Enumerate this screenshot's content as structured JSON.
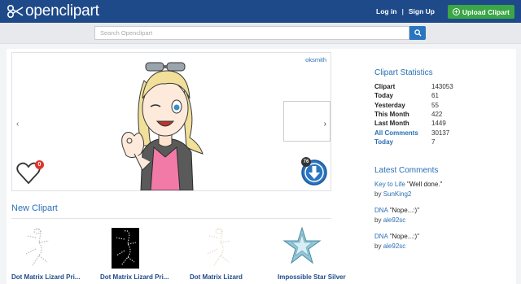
{
  "header": {
    "logo_text": "openclipart",
    "login": "Log in",
    "separator": "|",
    "signup": "Sign Up",
    "upload": "Upload Clipart",
    "brand_color": "#1f4a8a",
    "upload_color": "#3aa646"
  },
  "search": {
    "placeholder": "Search Openclipart",
    "icon": "search-icon"
  },
  "feature": {
    "author": "oksmith",
    "likes": "0",
    "downloads": "76",
    "prev": "‹",
    "next": "›"
  },
  "new_clipart": {
    "heading": "New Clipart",
    "items": [
      {
        "title": "Dot Matrix Lizard Pri..."
      },
      {
        "title": "Dot Matrix Lizard Pri..."
      },
      {
        "title": "Dot Matrix Lizard"
      },
      {
        "title": "Impossible Star Silver"
      }
    ]
  },
  "stats": {
    "heading": "Clipart Statistics",
    "rows": [
      {
        "label": "Clipart",
        "value": "143053"
      },
      {
        "label": "Today",
        "value": "61"
      },
      {
        "label": "Yesterday",
        "value": "55"
      },
      {
        "label": "This Month",
        "value": "422"
      },
      {
        "label": "Last Month",
        "value": "1449"
      },
      {
        "label": "All Comments",
        "value": "30137"
      },
      {
        "label": "Today",
        "value": "7"
      }
    ]
  },
  "comments": {
    "heading": "Latest Comments",
    "items": [
      {
        "title": "Key to Life",
        "quote": "\"Well done.\"",
        "by": "by",
        "user": "SunKing2"
      },
      {
        "title": "DNA",
        "quote": "\"Nope...:)\"",
        "by": "by",
        "user": "ale92sc"
      },
      {
        "title": "DNA",
        "quote": "\"Nope...:)\"",
        "by": "by",
        "user": "ale92sc"
      }
    ]
  }
}
